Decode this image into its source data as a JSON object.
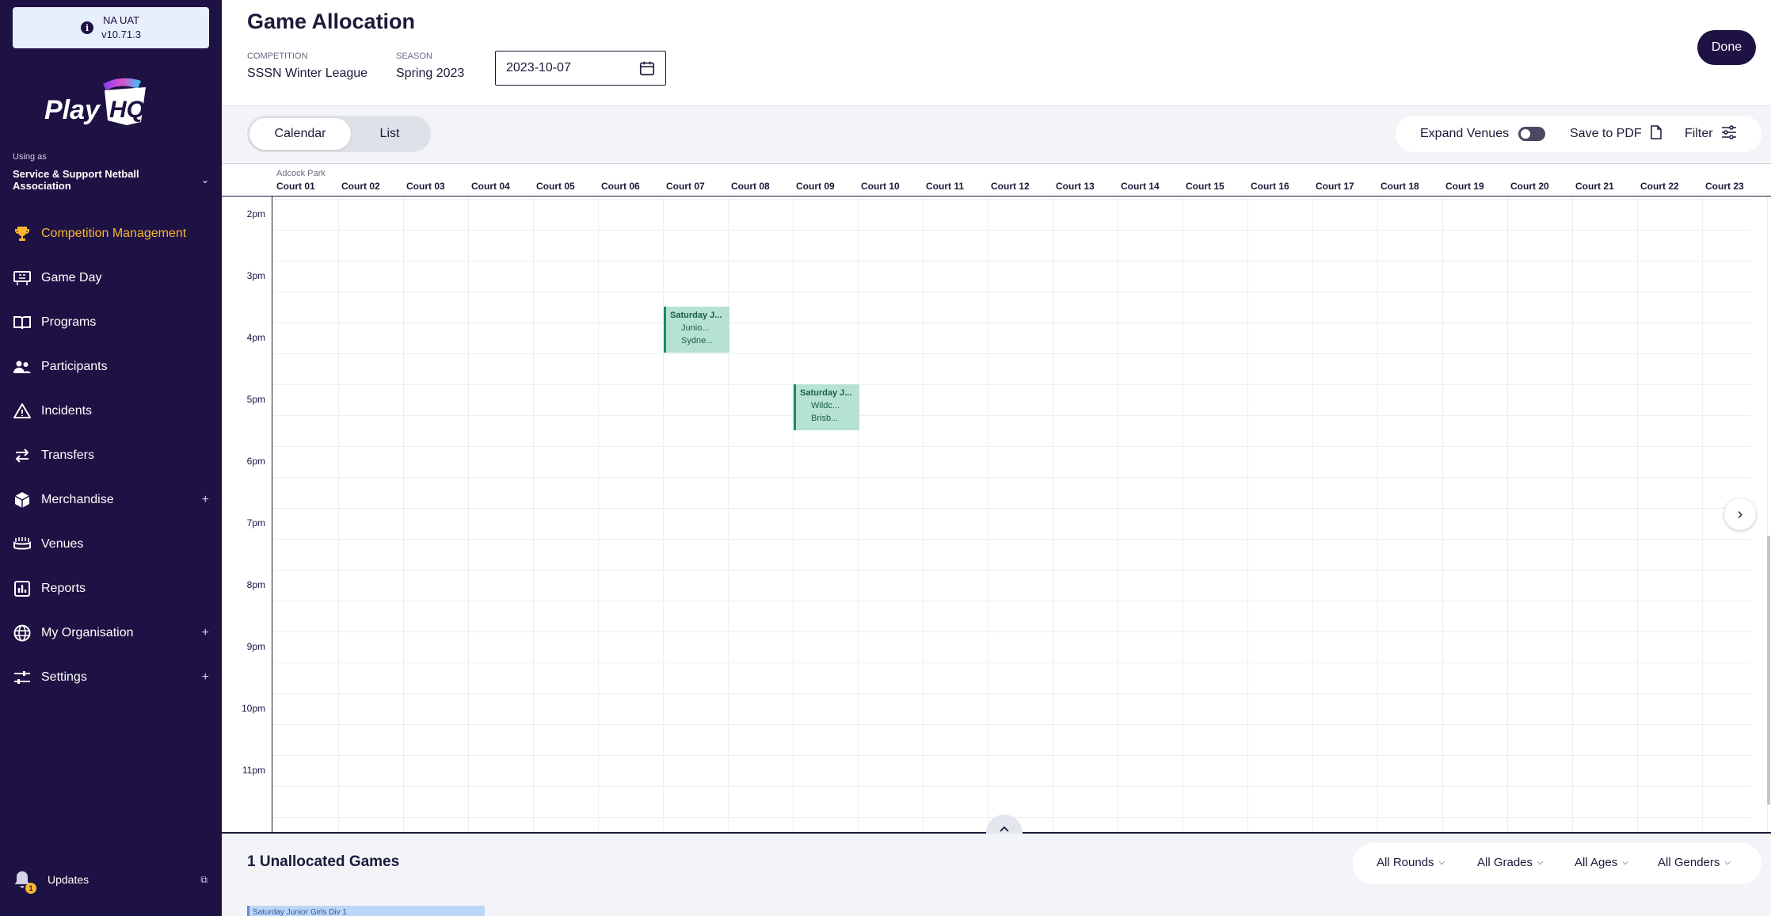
{
  "environment": {
    "name": "NA UAT",
    "version": "v10.71.3"
  },
  "brand": {
    "logo_text": "PlayHQ",
    "accent": "#f7b731",
    "sidebar_bg": "#1e1143"
  },
  "sidebar": {
    "using_as_label": "Using as",
    "organisation": "Service & Support Netball Association",
    "items": [
      {
        "label": "Competition Management",
        "icon": "trophy-icon",
        "active": true
      },
      {
        "label": "Game Day",
        "icon": "scoreboard-icon"
      },
      {
        "label": "Programs",
        "icon": "book-icon"
      },
      {
        "label": "Participants",
        "icon": "people-icon"
      },
      {
        "label": "Incidents",
        "icon": "warning-icon"
      },
      {
        "label": "Transfers",
        "icon": "transfer-arrows-icon"
      },
      {
        "label": "Merchandise",
        "icon": "box-icon",
        "expandable": true
      },
      {
        "label": "Venues",
        "icon": "stadium-icon"
      },
      {
        "label": "Reports",
        "icon": "report-icon"
      },
      {
        "label": "My Organisation",
        "icon": "globe-icon",
        "expandable": true
      },
      {
        "label": "Settings",
        "icon": "sliders-icon",
        "expandable": true
      }
    ],
    "expand_symbol": "+",
    "updates": {
      "label": "Updates",
      "badge": "1"
    }
  },
  "header": {
    "title": "Game Allocation",
    "competition_label": "COMPETITION",
    "competition_value": "SSSN Winter League",
    "season_label": "SEASON",
    "season_value": "Spring 2023",
    "date_value": "2023-10-07",
    "done_label": "Done"
  },
  "toolbar": {
    "tabs": [
      {
        "label": "Calendar",
        "selected": true
      },
      {
        "label": "List",
        "selected": false
      }
    ],
    "expand_venues_label": "Expand Venues",
    "expand_venues_on": false,
    "save_pdf_label": "Save to PDF",
    "filter_label": "Filter"
  },
  "calendar": {
    "venue": "Adcock Park",
    "courts": [
      "Court 01",
      "Court 02",
      "Court 03",
      "Court 04",
      "Court 05",
      "Court 06",
      "Court 07",
      "Court 08",
      "Court 09",
      "Court 10",
      "Court 11",
      "Court 12",
      "Court 13",
      "Court 14",
      "Court 15",
      "Court 16",
      "Court 17",
      "Court 18",
      "Court 19",
      "Court 20",
      "Court 21",
      "Court 22",
      "Court 23"
    ],
    "time_slots": [
      "2pm",
      "3pm",
      "4pm",
      "5pm",
      "6pm",
      "7pm",
      "8pm",
      "9pm",
      "10pm",
      "11pm"
    ],
    "events": [
      {
        "title": "Saturday J...",
        "lines": [
          "Junio...",
          "Sydne..."
        ],
        "court_index": 6,
        "start_hour": 15.5,
        "color": "#b6e2d2"
      },
      {
        "title": "Saturday J...",
        "lines": [
          "Wildc...",
          "Brisb..."
        ],
        "court_index": 8,
        "start_hour": 16.75,
        "color": "#b6e2d2"
      }
    ]
  },
  "unallocated": {
    "title": "1 Unallocated Games",
    "filters": [
      "All Rounds",
      "All Grades",
      "All Ages",
      "All Genders"
    ],
    "cards": [
      "Saturday Junior Girls Div 1"
    ]
  }
}
